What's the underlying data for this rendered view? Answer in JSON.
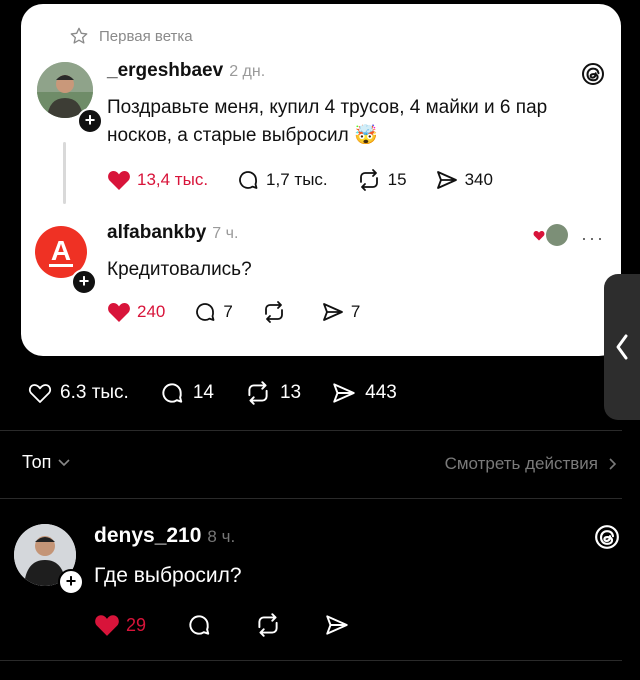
{
  "card": {
    "first_branch_label": "Первая ветка",
    "post": {
      "username": "_ergeshbaev",
      "time": "2 дн.",
      "text": "Поздравьте меня, купил 4 трусов, 4 майки и 6 пар носков, а старые выбросил",
      "emoji": "🤯",
      "likes": "13,4 тыс.",
      "replies": "1,7 тыс.",
      "reposts": "15",
      "shares": "340"
    },
    "reply": {
      "username": "alfabankby",
      "time": "7 ч.",
      "text": "Кредитовались?",
      "likes": "240",
      "replies": "7",
      "shares": "7",
      "avatar_letter": "A"
    }
  },
  "stats": {
    "likes": "6.3 тыс.",
    "replies": "14",
    "reposts": "13",
    "shares": "443"
  },
  "sort": {
    "label": "Топ",
    "view_actions": "Смотреть действия"
  },
  "comment": {
    "username": "denys_210",
    "time": "8 ч.",
    "text": "Где выбросил?",
    "likes": "29"
  },
  "colors": {
    "like_red": "#d8143a",
    "alfa_red": "#ef3124",
    "background": "#000000",
    "card": "#ffffff"
  }
}
